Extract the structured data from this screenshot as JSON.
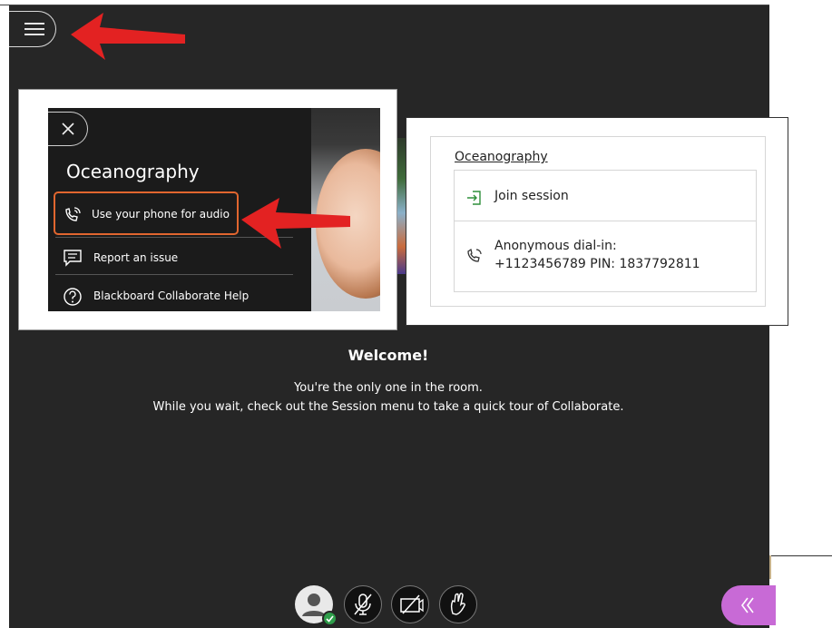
{
  "session_panel": {
    "title": "Oceanography",
    "items": [
      {
        "label": "Use your phone for audio",
        "icon": "phone-audio-icon"
      },
      {
        "label": "Report an issue",
        "icon": "report-icon"
      },
      {
        "label": "Blackboard Collaborate Help",
        "icon": "help-icon"
      }
    ]
  },
  "join_card": {
    "title": "Oceanography",
    "join_label": "Join session",
    "dial_in_line1": "Anonymous dial-in:",
    "dial_in_line2": "+1123456789 PIN: 1837792811"
  },
  "main": {
    "welcome": "Welcome!",
    "line1": "You're the only one in the room.",
    "line2": "While you wait, check out the Session menu to take a quick tour of Collaborate."
  },
  "colors": {
    "background": "#262626",
    "highlight": "#e1662f",
    "accent_purple": "#c86ad6",
    "status_green": "#2e9d4a",
    "annotation_red": "#e32222"
  }
}
